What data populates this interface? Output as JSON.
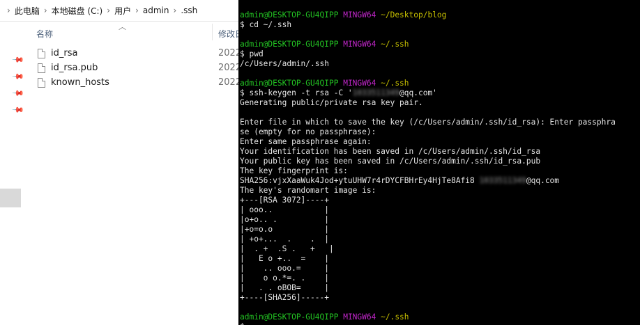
{
  "explorer": {
    "breadcrumb": [
      "此电脑",
      "本地磁盘 (C:)",
      "用户",
      "admin",
      ".ssh"
    ],
    "breadcrumb_separator": "›",
    "columns": {
      "name": "名称",
      "modified": "修改日"
    },
    "files": [
      {
        "name": "id_rsa",
        "date": "2022"
      },
      {
        "name": "id_rsa.pub",
        "date": "2022"
      },
      {
        "name": "known_hosts",
        "date": "2022"
      }
    ]
  },
  "terminal": {
    "colors": {
      "user": "#23c423",
      "host": "#c026c9",
      "path": "#c8c100",
      "text": "#e6e6e6",
      "background": "#000000"
    },
    "prompt_user": "admin@DESKTOP-GU4QIPP",
    "prompt_env": "MINGW64",
    "path_blog": "~/Desktop/blog",
    "path_ssh": "~/.ssh",
    "cmd_cd": "$ cd ~/.ssh",
    "cmd_pwd": "$ pwd",
    "out_pwd": "/c/Users/admin/.ssh",
    "cmd_keygen_prefix": "$ ssh-keygen -t rsa -C '",
    "cmd_keygen_blurred": "1033511349",
    "cmd_keygen_suffix": "@qq.com'",
    "keygen_output": [
      "Generating public/private rsa key pair.",
      "",
      "Enter file in which to save the key (/c/Users/admin/.ssh/id_rsa): Enter passphra",
      "se (empty for no passphrase):",
      "Enter same passphrase again:",
      "Your identification has been saved in /c/Users/admin/.ssh/id_rsa",
      "Your public key has been saved in /c/Users/admin/.ssh/id_rsa.pub",
      "The key fingerprint is:"
    ],
    "fingerprint_prefix": "SHA256:vjxXaaWuk4Jod+ytuUHW7r4rDYCFBHrEy4HjTe8Afi8 ",
    "fingerprint_blurred": "1033511349",
    "fingerprint_suffix": "@qq.com",
    "randomart_header": "The key's randomart image is:",
    "randomart": [
      "+---[RSA 3072]----+",
      "| ooo..           |",
      "|o+o.. .          |",
      "|+o=o.o           |",
      "| +o+...  .    .  |",
      "|  . +  .S .   +   |",
      "|   E o +..  =    |",
      "|    .. ooo.=     |",
      "|    o o.*=. .    |",
      "|   . . oBOB=     |",
      "+----[SHA256]-----+"
    ],
    "last_line": "$"
  }
}
